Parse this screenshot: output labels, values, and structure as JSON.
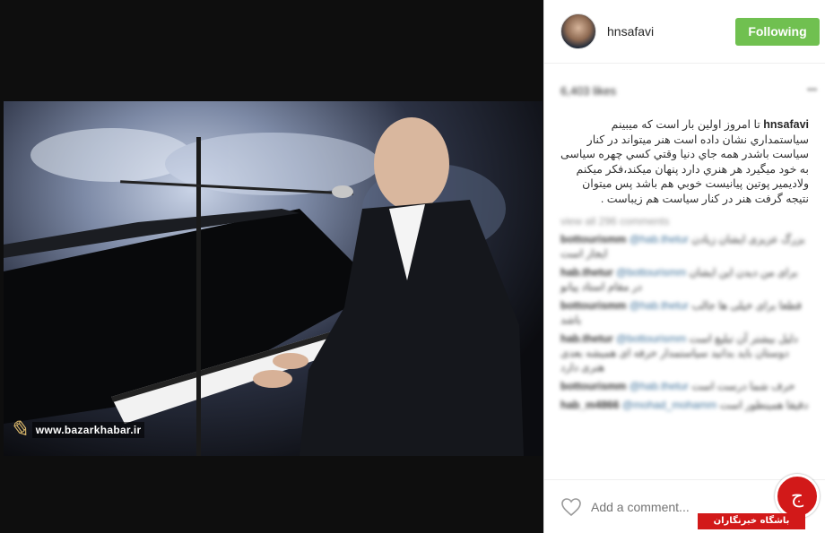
{
  "post": {
    "username": "hnsafavi",
    "follow_label": "Following",
    "likes_text": "6,403 likes",
    "caption_user": "hnsafavi",
    "caption_text": "تا امروز اولين بار است كه ميبينم سياستمداري نشان داده است هنر ميتواند در كنار سياست باشدر همه جاي دنيا وقتي كسي چهره سياسی به خود ميگيرد هر هنري دارد پنهان ميكند،فكر ميكنم ولاديمير پوتين پيانيست خوبي هم باشد پس ميتوان نتيجه گرفت هنر در كنار سياست هم زيباست .",
    "view_all": "view all 296 comments",
    "comments": [
      {
        "user": "bottourismm",
        "extra": "@hab.thetur",
        "text": "بزرگ عزیزی ایشان زیادن ایجار است"
      },
      {
        "user": "hab.thetur",
        "extra": "@bottourismm",
        "text": "برای من دیدن این ایشان در مقام استاد پیانو"
      },
      {
        "user": "bottourismm",
        "extra": "@hab.thetur",
        "text": "قطعا برای خیلی ها جالب باشد"
      },
      {
        "user": "hab.thetur",
        "extra": "@bottourismm",
        "text": "دلیل بیشتر آن تبلیغ است دوستان باید بدانید سیاستمدار حرفه ای همیشه بعدی هنری دارد"
      },
      {
        "user": "bottourismm",
        "extra": "@hab.thetur",
        "text": "حرف شما درست است"
      },
      {
        "user": "hab_m4866",
        "extra": "@mohad_mohamm",
        "text": "دقیقا همینطور است"
      }
    ],
    "comment_placeholder": "Add a comment..."
  },
  "watermark": {
    "site": "www.bazarkhabar.ir"
  },
  "club": {
    "label": "باشگاه خبرنگاران"
  },
  "colors": {
    "follow_bg": "#70c050",
    "club_red": "#d21919",
    "media_bg": "#0e0e0e"
  },
  "icons": {
    "like": "heart-icon",
    "more": "more-options-icon",
    "club": "news-club-logo-icon"
  }
}
